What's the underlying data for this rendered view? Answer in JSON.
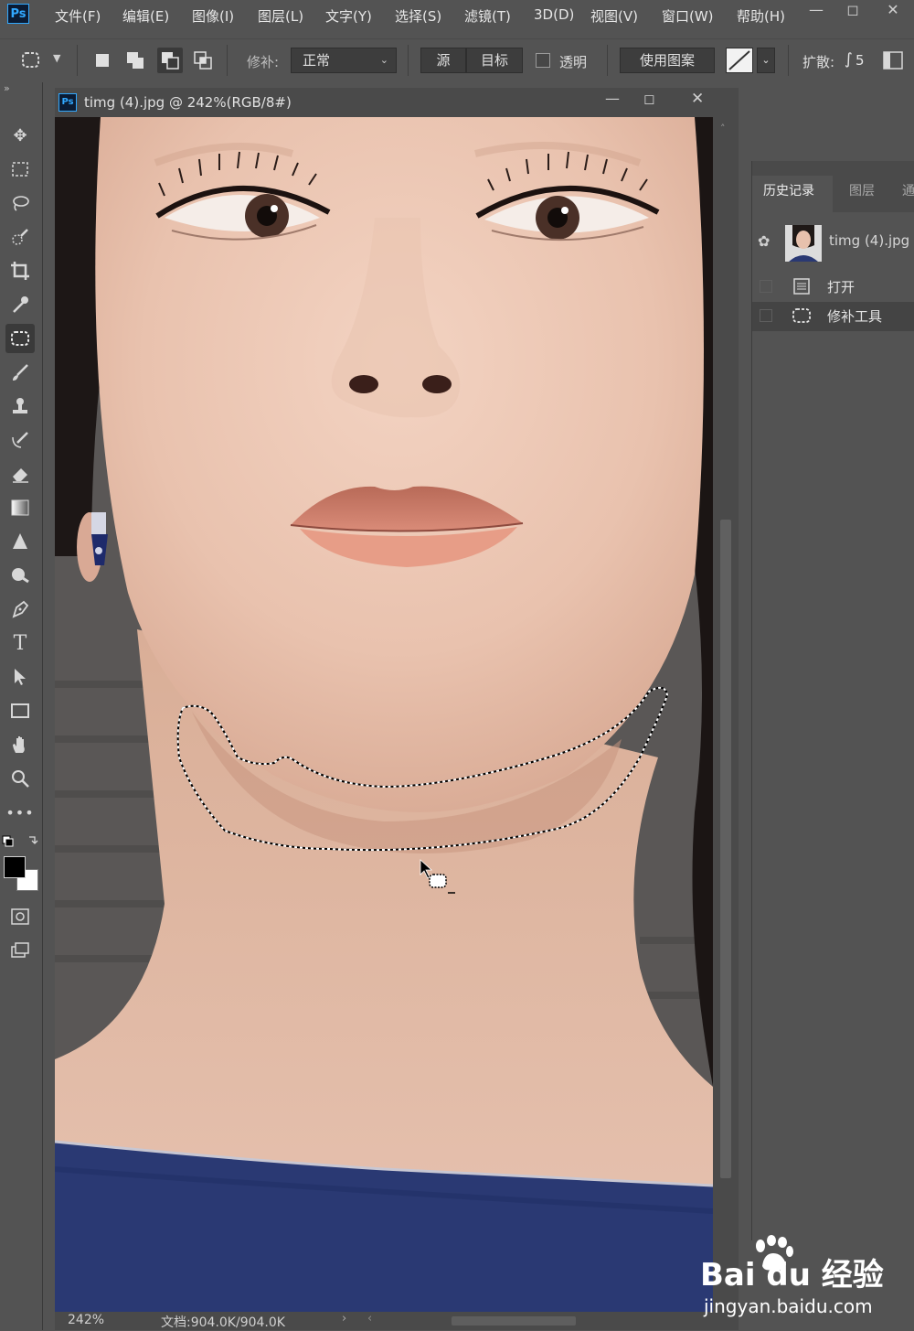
{
  "app": {
    "logo": "Ps"
  },
  "menu": [
    "文件(F)",
    "编辑(E)",
    "图像(I)",
    "图层(L)",
    "文字(Y)",
    "选择(S)",
    "滤镜(T)",
    "3D(D)",
    "视图(V)",
    "窗口(W)",
    "帮助(H)"
  ],
  "options": {
    "patch_label": "修补:",
    "patch_value": "正常",
    "source_btn": "源",
    "target_btn": "目标",
    "transparent_label": "透明",
    "use_pattern_btn": "使用图案",
    "diffusion_label": "扩散:",
    "diffusion_value": "5"
  },
  "document": {
    "title": "timg (4).jpg @ 242%(RGB/8#)",
    "zoom": "242%",
    "doc_size": "文档:904.0K/904.0K"
  },
  "panel": {
    "tabs": [
      "历史记录",
      "图层",
      "通"
    ],
    "snapshot_name": "timg (4).jpg",
    "history": [
      "打开",
      "修补工具"
    ]
  },
  "watermark": {
    "brand": "Bai du 经验",
    "url": "jingyan.baidu.com"
  },
  "colors": {
    "accent": "#31a8ff",
    "dark": "#3a3a3a",
    "bg": "#535353"
  }
}
